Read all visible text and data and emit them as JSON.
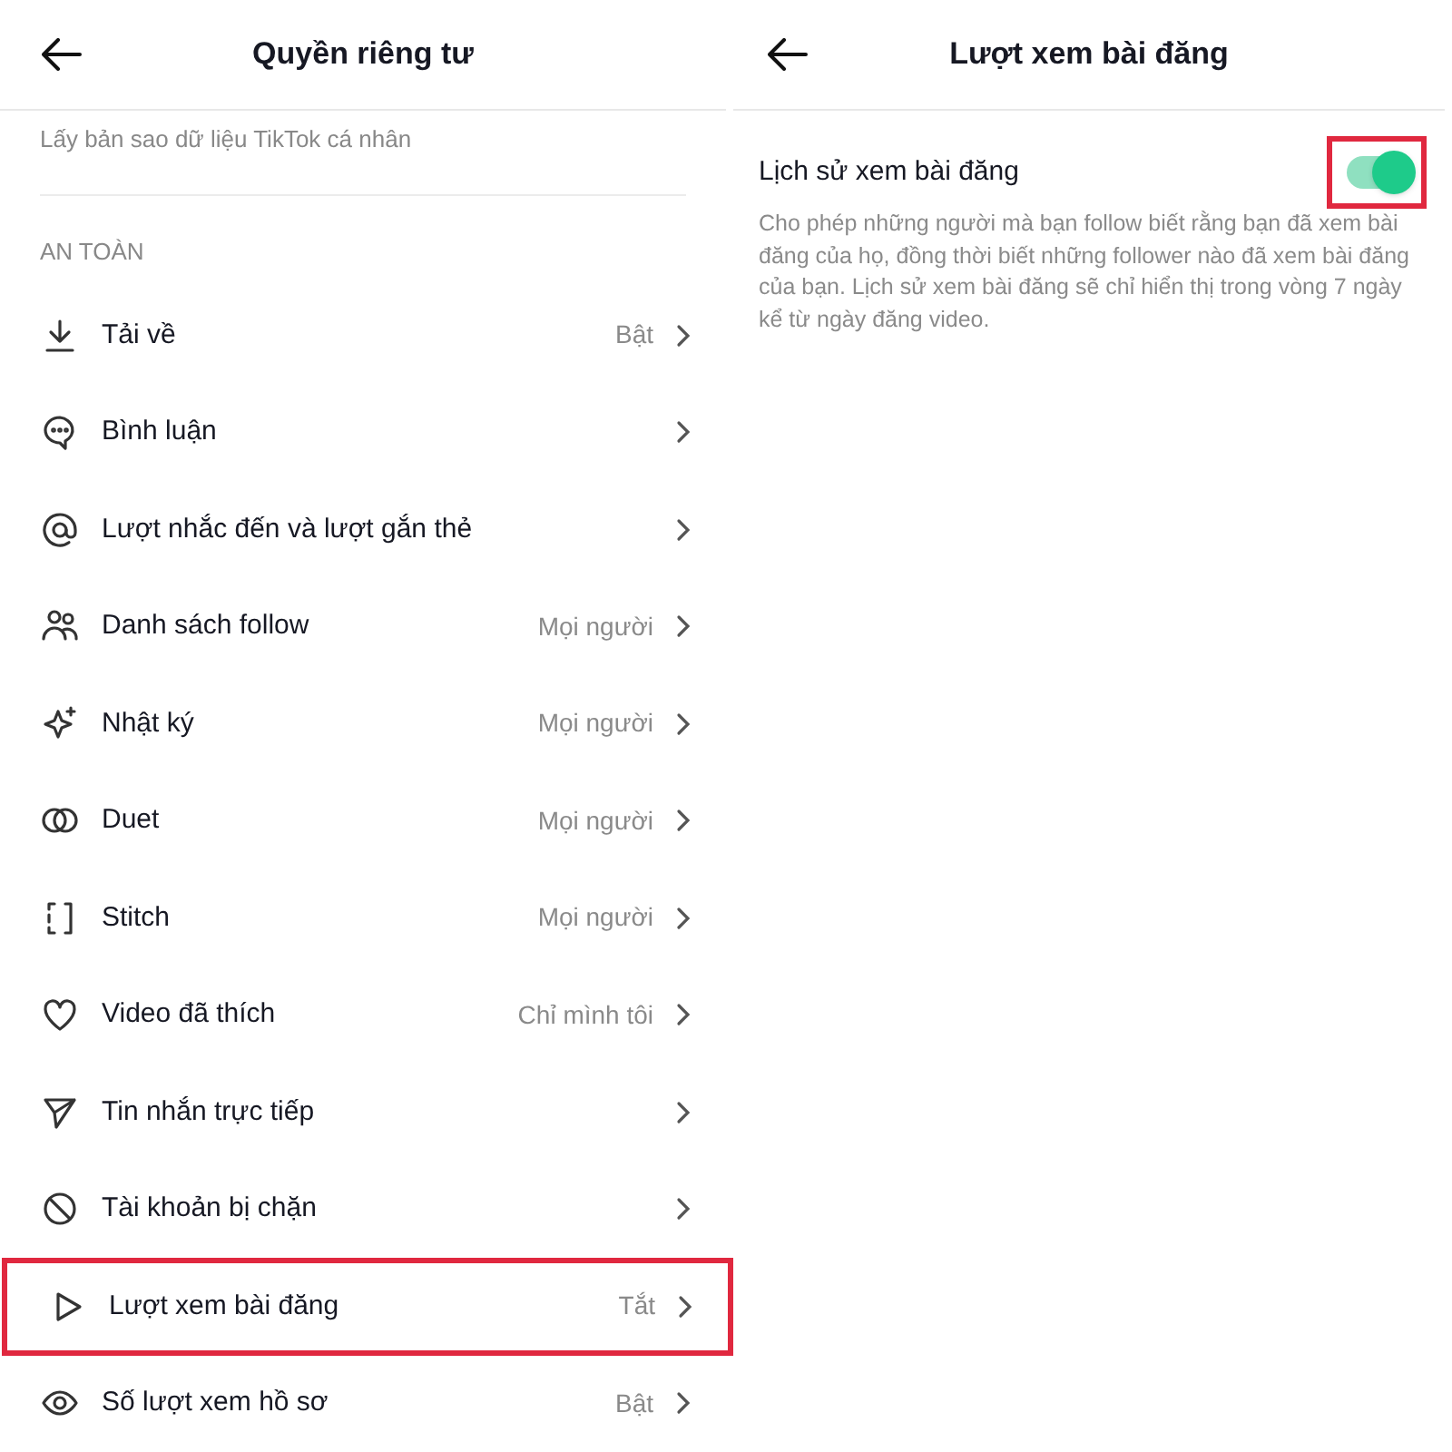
{
  "privacy_screen": {
    "title": "Quyền riêng tư",
    "note": "Lấy bản sao dữ liệu TikTok cá nhân",
    "section": "AN TOÀN",
    "items": [
      {
        "label": "Tải về",
        "value": "Bật",
        "highlighted": false
      },
      {
        "label": "Bình luận",
        "highlighted": false
      },
      {
        "label": "Lượt nhắc đến và lượt gắn thẻ",
        "highlighted": false
      },
      {
        "label": "Danh sách follow",
        "value": "Mọi người",
        "highlighted": false
      },
      {
        "label": "Nhật ký",
        "value": "Mọi người",
        "highlighted": false
      },
      {
        "label": "Duet",
        "value": "Mọi người",
        "highlighted": false
      },
      {
        "label": "Stitch",
        "value": "Mọi người",
        "highlighted": false
      },
      {
        "label": "Video đã thích",
        "value": "Chỉ mình tôi",
        "highlighted": false
      },
      {
        "label": "Tin nhắn trực tiếp",
        "highlighted": false
      },
      {
        "label": "Tài khoản bị chặn",
        "highlighted": false
      },
      {
        "label": "Lượt xem bài đăng",
        "value": "Tắt",
        "highlighted": true
      },
      {
        "label": "Số lượt xem hồ sơ",
        "value": "Bật",
        "highlighted": false
      }
    ]
  },
  "post_views_screen": {
    "title": "Lượt xem bài đăng",
    "setting": {
      "label": "Lịch sử xem bài đăng",
      "on": true,
      "highlighted": true,
      "description": "Cho phép những người mà bạn follow biết rằng bạn đã xem bài đăng của họ, đồng thời biết những follower nào đã xem bài đăng của bạn. Lịch sử xem bài đăng sẽ chỉ hiển thị trong vòng 7 ngày kể từ ngày đăng video."
    }
  }
}
